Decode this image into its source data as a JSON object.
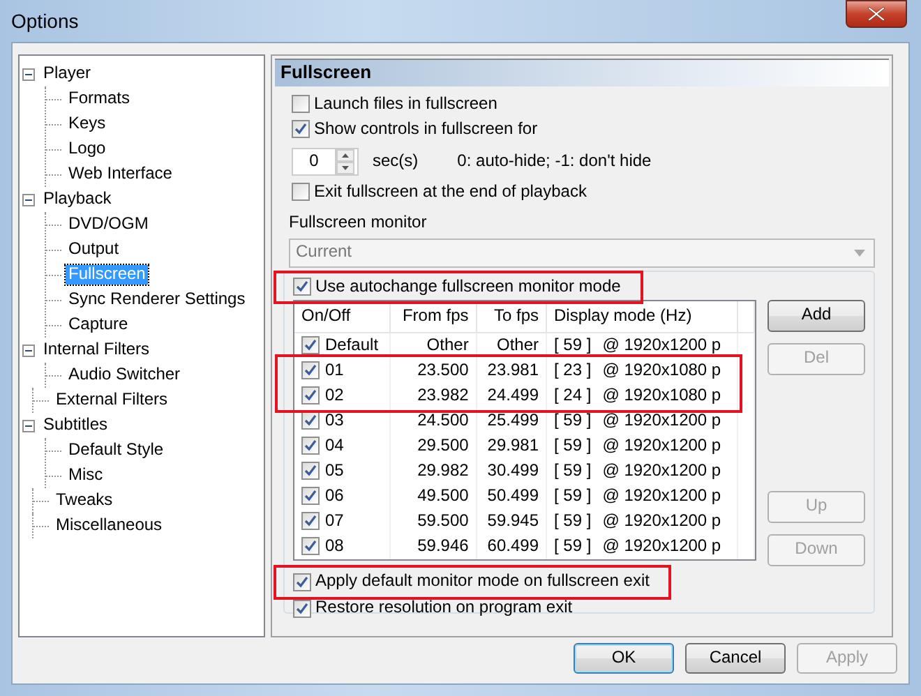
{
  "window": {
    "title": "Options"
  },
  "tree": [
    {
      "label": "Player",
      "expanded": true,
      "selected": false,
      "children": [
        {
          "label": "Formats",
          "selected": false
        },
        {
          "label": "Keys",
          "selected": false
        },
        {
          "label": "Logo",
          "selected": false
        },
        {
          "label": "Web Interface",
          "selected": false
        }
      ]
    },
    {
      "label": "Playback",
      "expanded": true,
      "selected": false,
      "children": [
        {
          "label": "DVD/OGM",
          "selected": false
        },
        {
          "label": "Output",
          "selected": false
        },
        {
          "label": "Fullscreen",
          "selected": true
        },
        {
          "label": "Sync Renderer Settings",
          "selected": false
        },
        {
          "label": "Capture",
          "selected": false
        }
      ]
    },
    {
      "label": "Internal Filters",
      "expanded": true,
      "selected": false,
      "children": [
        {
          "label": "Audio Switcher",
          "selected": false
        }
      ]
    },
    {
      "label": "External Filters",
      "selected": false
    },
    {
      "label": "Subtitles",
      "expanded": true,
      "selected": false,
      "children": [
        {
          "label": "Default Style",
          "selected": false
        },
        {
          "label": "Misc",
          "selected": false
        }
      ]
    },
    {
      "label": "Tweaks",
      "selected": false
    },
    {
      "label": "Miscellaneous",
      "selected": false
    }
  ],
  "page": {
    "title": "Fullscreen",
    "top_options": [
      {
        "kind": "checkbox",
        "label": "Launch files in fullscreen",
        "checked": false
      },
      {
        "kind": "checkbox",
        "label": "Show controls in fullscreen for",
        "checked": true
      },
      {
        "kind": "spin",
        "value": "0",
        "unit": "sec(s)",
        "hint": "0: auto-hide; -1: don't hide"
      },
      {
        "kind": "checkbox",
        "label": "Exit fullscreen at the end of playback",
        "checked": false
      }
    ],
    "monitor": {
      "label": "Fullscreen monitor",
      "value": "Current",
      "disabled": true
    },
    "autochange": {
      "label": "Use autochange fullscreen monitor mode",
      "checked": true,
      "highlighted": true
    },
    "modes": {
      "columns": [
        "On/Off",
        "From fps",
        "To fps",
        "Display mode (Hz)"
      ],
      "rows": [
        {
          "name": "Default",
          "checked": true,
          "from": "Other",
          "to": "Other",
          "refresh": "[ 59 ]",
          "resolution": "@ 1920x1200 p",
          "highlighted": false
        },
        {
          "name": "01",
          "checked": true,
          "from": "23.500",
          "to": "23.981",
          "refresh": "[ 23 ]",
          "resolution": "@ 1920x1080 p",
          "highlighted": true
        },
        {
          "name": "02",
          "checked": true,
          "from": "23.982",
          "to": "24.499",
          "refresh": "[ 24 ]",
          "resolution": "@ 1920x1080 p",
          "highlighted": true
        },
        {
          "name": "03",
          "checked": true,
          "from": "24.500",
          "to": "25.499",
          "refresh": "[ 59 ]",
          "resolution": "@ 1920x1200 p",
          "highlighted": false
        },
        {
          "name": "04",
          "checked": true,
          "from": "29.500",
          "to": "29.981",
          "refresh": "[ 59 ]",
          "resolution": "@ 1920x1200 p",
          "highlighted": false
        },
        {
          "name": "05",
          "checked": true,
          "from": "29.982",
          "to": "30.499",
          "refresh": "[ 59 ]",
          "resolution": "@ 1920x1200 p",
          "highlighted": false
        },
        {
          "name": "06",
          "checked": true,
          "from": "49.500",
          "to": "50.499",
          "refresh": "[ 59 ]",
          "resolution": "@ 1920x1200 p",
          "highlighted": false
        },
        {
          "name": "07",
          "checked": true,
          "from": "59.500",
          "to": "59.945",
          "refresh": "[ 59 ]",
          "resolution": "@ 1920x1200 p",
          "highlighted": false
        },
        {
          "name": "08",
          "checked": true,
          "from": "59.946",
          "to": "60.499",
          "refresh": "[ 59 ]",
          "resolution": "@ 1920x1200 p",
          "highlighted": false
        }
      ]
    },
    "side_buttons": [
      {
        "label": "Add",
        "kind": "edit",
        "disabled": false
      },
      {
        "label": "Del",
        "kind": "edit",
        "disabled": true
      },
      {
        "label": "Up",
        "kind": "order",
        "disabled": true
      },
      {
        "label": "Down",
        "kind": "order",
        "disabled": true
      }
    ],
    "bottom_options": [
      {
        "label": "Apply default monitor mode on fullscreen exit",
        "checked": true,
        "highlighted": true
      },
      {
        "label": "Restore resolution on program exit",
        "checked": true,
        "highlighted": false
      }
    ]
  },
  "dialog_buttons": [
    {
      "label": "OK",
      "default": true,
      "disabled": false
    },
    {
      "label": "Cancel",
      "default": false,
      "disabled": false
    },
    {
      "label": "Apply",
      "default": false,
      "disabled": true
    }
  ]
}
